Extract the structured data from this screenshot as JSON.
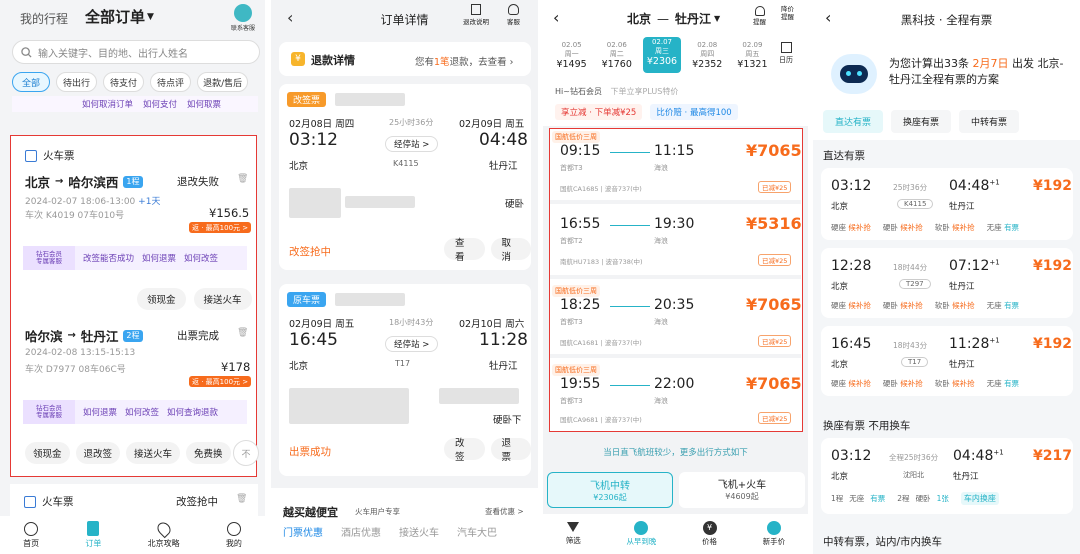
{
  "s1": {
    "tab_trip": "我的行程",
    "tab_orders": "全部订单",
    "support": "联系客服",
    "search_placeholder": "输入关键字、目的地、出行人姓名",
    "filters": [
      "全部",
      "待出行",
      "待支付",
      "待点评",
      "退款/售后"
    ],
    "vip_links_top": [
      "如何取消订单",
      "如何支付",
      "如何取票"
    ],
    "vip_label": "钻石会员\n专属客服",
    "card1": {
      "type": "火车票",
      "from": "北京",
      "to": "哈尔滨西",
      "trips": "1程",
      "status": "退改失败",
      "time": "2024-02-07 18:06-13:00",
      "plus": "+1天",
      "train": "车次 K4019  07车010号",
      "price": "¥156.5",
      "reward": "返 · 最高100元 >",
      "links": [
        "改签能否成功",
        "如何退票",
        "如何改签"
      ],
      "buttons": [
        "领现金",
        "接送火车"
      ]
    },
    "card2": {
      "from": "哈尔滨",
      "to": "牡丹江",
      "trips": "2程",
      "status": "出票完成",
      "time": "2024-02-08  13:15-15:13",
      "train": "车次 D7977  08车06C号",
      "price": "¥178",
      "reward": "返 · 最高100元 >",
      "links": [
        "如何退票",
        "如何改签",
        "如何查询退款"
      ],
      "buttons": [
        "领现金",
        "退改签",
        "接送火车",
        "免费换"
      ],
      "more": "不"
    },
    "card3": {
      "type": "火车票",
      "status": "改签抢中"
    },
    "nav": [
      "首页",
      "订单",
      "北京攻略",
      "我的"
    ]
  },
  "s2": {
    "title": "订单详情",
    "explain": "退改说明",
    "service": "客服",
    "refund_title": "退款详情",
    "refund_text_pre": "您有",
    "refund_count": "1笔",
    "refund_text_post": "退款，去查看",
    "change": {
      "tag": "改签票",
      "dep_date": "02月08日 周四",
      "duration": "25小时36分",
      "arr_date": "02月09日 周五",
      "dep_time": "03:12",
      "arr_time": "04:48",
      "stops": "经停站 >",
      "dep_station": "北京",
      "train": "K4115",
      "arr_station": "牡丹江",
      "seat": "硬卧",
      "status": "改签抢中",
      "buttons": [
        "查看",
        "取消"
      ]
    },
    "origin": {
      "tag": "原车票",
      "dep_date": "02月09日 周五",
      "duration": "18小时43分",
      "arr_date": "02月10日 周六",
      "dep_time": "16:45",
      "arr_time": "11:28",
      "stops": "经停站 >",
      "dep_station": "北京",
      "train": "T17",
      "arr_station": "牡丹江",
      "seat": "硬卧下",
      "status": "出票成功",
      "buttons": [
        "改签",
        "退票"
      ]
    },
    "promo": "越买越便宜",
    "promo_sub": "火车用户专享",
    "promo_more": "查看优惠 >",
    "promo_tabs": [
      "门票优惠",
      "酒店优惠",
      "接送火车",
      "汽车大巴"
    ]
  },
  "s3": {
    "from": "北京",
    "to": "牡丹江",
    "alert": "提醒",
    "low_price": "降价\n提醒",
    "calendar": "日历",
    "dates": [
      {
        "d": "02.05",
        "w": "周一",
        "p": "¥1495"
      },
      {
        "d": "02.06",
        "w": "周二",
        "p": "¥1760"
      },
      {
        "d": "02.07",
        "w": "周三",
        "p": "¥2306"
      },
      {
        "d": "02.08",
        "w": "周四",
        "p": "¥2352"
      },
      {
        "d": "02.09",
        "w": "周五",
        "p": "¥1321"
      }
    ],
    "member": "Hi~钻石会员",
    "member_sub": "下单立享PLUS特价",
    "promo_a": "享立减 · 下单减¥25",
    "promo_b": "比价赔 · 最高得100",
    "flights": [
      {
        "tag": "国航低价三周",
        "dep": "09:15",
        "arr": "11:15",
        "dep_ap": "首都T3",
        "arr_ap": "海浪",
        "price": "¥7065",
        "airline": "国航CA1685 | 波音737(中)",
        "badge": "已减¥25"
      },
      {
        "tag": "",
        "dep": "16:55",
        "arr": "19:30",
        "dep_ap": "首都T2",
        "arr_ap": "海浪",
        "price": "¥5316",
        "airline": "南航HU7183 | 波音738(中)",
        "badge": "已减¥25"
      },
      {
        "tag": "国航低价三周",
        "dep": "18:25",
        "arr": "20:35",
        "dep_ap": "首都T3",
        "arr_ap": "海浪",
        "price": "¥7065",
        "airline": "国航CA1681 | 波音737(中)",
        "badge": "已减¥25"
      },
      {
        "tag": "国航低价三周",
        "dep": "19:55",
        "arr": "22:00",
        "dep_ap": "首都T3",
        "arr_ap": "海浪",
        "price": "¥7065",
        "airline": "国航CA9681 | 波音737(中)",
        "badge": "已减¥25"
      }
    ],
    "notice": "当日直飞航班较少，更多出行方式如下",
    "opt1": "飞机中转",
    "opt1_price": "¥2306起",
    "opt2": "飞机+火车",
    "opt2_price": "¥4609起",
    "nav": [
      "筛选",
      "从早到晚",
      "价格",
      "新手价"
    ]
  },
  "s4": {
    "title": "黑科技 · 全程有票",
    "hero_pre": "为您计算出33条",
    "hero_date": "2月7日",
    "hero_post": "出发 北京-牡丹江全程有票的方案",
    "tabs": [
      "直达有票",
      "换座有票",
      "中转有票"
    ],
    "sec1": "直达有票",
    "direct": [
      {
        "dep": "03:12",
        "dur": "25时36分",
        "arr": "04:48",
        "plus": "+1",
        "price": "¥192",
        "from": "北京",
        "train": "K4115",
        "to": "牡丹江",
        "s1": "硬座",
        "s1v": "候补抢",
        "s2": "硬卧",
        "s2v": "候补抢",
        "s3": "软卧",
        "s3v": "候补抢",
        "s4": "无座",
        "s4v": "有票"
      },
      {
        "dep": "12:28",
        "dur": "18时44分",
        "arr": "07:12",
        "plus": "+1",
        "price": "¥192",
        "from": "北京",
        "train": "T297",
        "to": "牡丹江",
        "s1": "硬座",
        "s1v": "候补抢",
        "s2": "硬卧",
        "s2v": "候补抢",
        "s3": "软卧",
        "s3v": "候补抢",
        "s4": "无座",
        "s4v": "有票"
      },
      {
        "dep": "16:45",
        "dur": "18时43分",
        "arr": "11:28",
        "plus": "+1",
        "price": "¥192",
        "from": "北京",
        "train": "T17",
        "to": "牡丹江",
        "s1": "硬座",
        "s1v": "候补抢",
        "s2": "硬卧",
        "s2v": "候补抢",
        "s3": "软卧",
        "s3v": "候补抢",
        "s4": "无座",
        "s4v": "有票"
      }
    ],
    "sec2": "换座有票 不用换车",
    "change": {
      "dep": "03:12",
      "dur": "全程25时36分",
      "arr": "04:48",
      "plus": "+1",
      "price": "¥217",
      "from": "北京",
      "mid": "沈阳北",
      "to": "牡丹江",
      "l1": "1程",
      "l1a": "无座",
      "l1b": "有票",
      "l2": "2程",
      "l2a": "硬卧",
      "l2b": "1张",
      "tag": "车内换座"
    },
    "sec3": "中转有票，站内/市内换车"
  }
}
